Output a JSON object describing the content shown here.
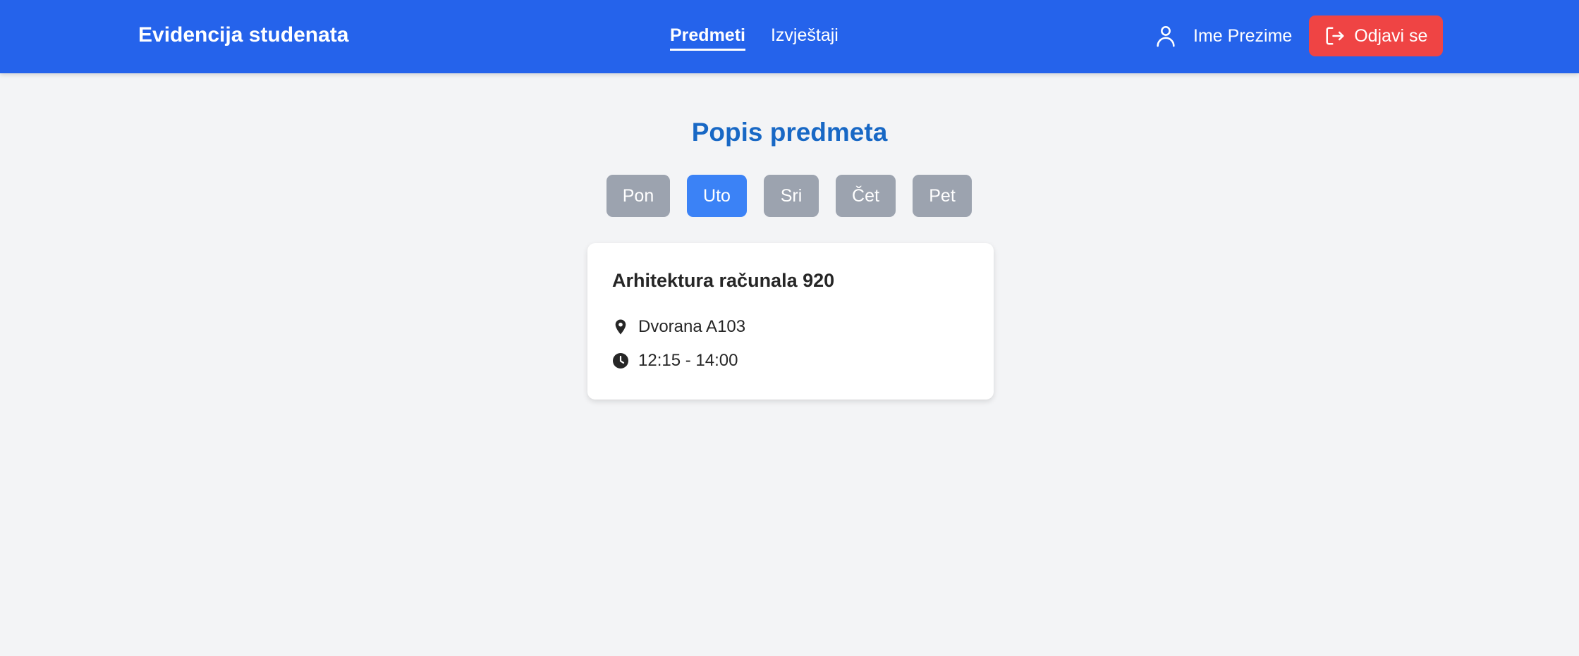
{
  "header": {
    "brand": "Evidencija studenata",
    "nav": [
      {
        "label": "Predmeti",
        "active": true
      },
      {
        "label": "Izvještaji",
        "active": false
      }
    ],
    "user_icon": "user-icon",
    "user_name": "Ime Prezime",
    "logout_icon": "logout-icon",
    "logout_label": "Odjavi se"
  },
  "main": {
    "title": "Popis predmeta",
    "days": [
      {
        "label": "Pon",
        "active": false
      },
      {
        "label": "Uto",
        "active": true
      },
      {
        "label": "Sri",
        "active": false
      },
      {
        "label": "Čet",
        "active": false
      },
      {
        "label": "Pet",
        "active": false
      }
    ],
    "courses": [
      {
        "name": "Arhitektura računala 920",
        "location_icon": "location-pin-icon",
        "location": "Dvorana A103",
        "time_icon": "clock-icon",
        "time": "12:15 - 14:00"
      }
    ]
  },
  "colors": {
    "navbar": "#2563eb",
    "title": "#1868c5",
    "active_day": "#3b82f6",
    "inactive_day": "#9ca3af",
    "logout": "#ef4444",
    "background": "#f3f4f6"
  }
}
